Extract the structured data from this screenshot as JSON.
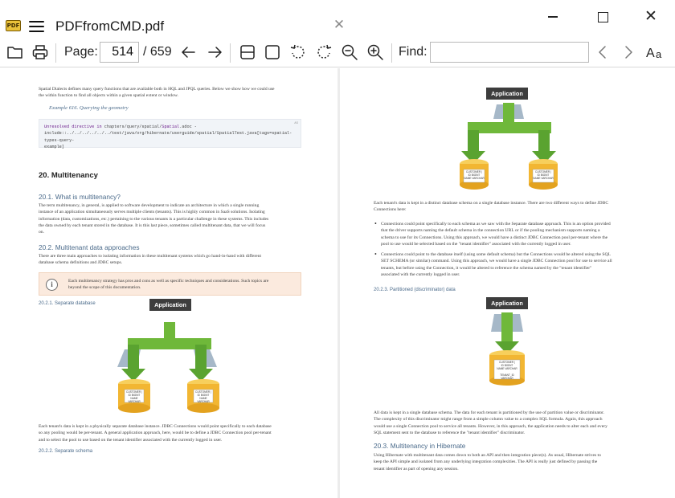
{
  "window": {
    "logo_text": "PDF",
    "tab_title": "PDFfromCMD.pdf"
  },
  "toolbar": {
    "page_label": "Page:",
    "page_current": "514",
    "page_total": "/ 659",
    "find_label": "Find:",
    "find_value": ""
  },
  "left_page": {
    "intro_line1": "Spatial Dialects defines many query functions that are available both in HQL and JPQL queries. Below we show how we could use",
    "intro_line2": "the within function to find all objects within a given spatial extent or window.",
    "example_caption": "Example 616. Querying the geometry",
    "code_line1_keyword": "Unresolved directive in",
    "code_line1_path": " chapters/query/spatial/",
    "code_line1_file": "Spatial",
    "code_line1_rest": ".adoc -",
    "code_line2": "include::../../../../../../test/java/org/hibernate/userguide/spatial/SpatialTest.java[tags=spatial-types-query-",
    "code_line3": "example]",
    "code_badge": "AS",
    "h_multitenancy": "20. Multitenancy",
    "h_what": "20.1. What is multitenancy?",
    "what_text": [
      "The term multitenancy, in general, is applied to software development to indicate an architecture in which a single running",
      "instance of an application simultaneously serves multiple clients (tenants). This is highly common in SaaS solutions. Isolating",
      "information (data, customizations, etc.) pertaining to the various tenants is a particular challenge in these systems. This includes",
      "the data owned by each tenant stored in the database. It is this last piece, sometimes called multitenant data, that we will focus",
      "on."
    ],
    "h_approaches": "20.2. Multitenant data approaches",
    "approaches_text": [
      "There are three main approaches to isolating information in these multitenant systems which go hand-in-hand with different",
      "database schema definitions and JDBC setups."
    ],
    "note_text": [
      "Each multitenancy strategy has pros and cons as well as specific techniques and considerations. Such topics are",
      "beyond the scope of this documentation."
    ],
    "h_separate_db": "20.2.1. Separate database",
    "diagram_label": "Application",
    "db_label_lines": [
      "CUSTOMER |",
      "ID BIGINT",
      "NAME VARCHAR"
    ],
    "separate_db_text": [
      "Each tenant's data is kept in a physically separate database instance. JDBC Connections would point specifically to each database",
      "so any pooling would be per-tenant. A general application approach, here, would be to define a JDBC Connection pool per-tenant",
      "and to select the pool to use based on the tenant identifier associated with the currently logged in user."
    ],
    "h_separate_schema": "20.2.2. Separate schema"
  },
  "right_page": {
    "diagram_label": "Application",
    "db_label_lines": [
      "CUSTOMER |",
      "ID BIGINT",
      "NAME VARCHAR"
    ],
    "schema_text": [
      "Each tenant's data is kept in a distinct database schema on a single database instance. There are two different ways to define JDBC",
      "Connections here:"
    ],
    "bullet1": [
      "Connections could point specifically to each schema as we saw with the Separate database approach. This is an option provided",
      "that the driver supports naming the default schema in the connection URL or if the pooling mechanism supports naming a",
      "schema to use for its Connections. Using this approach, we would have a distinct JDBC Connection pool per-tenant where the",
      "pool to use would be selected based on the \"tenant identifier\" associated with the currently logged in user."
    ],
    "bullet2": [
      "Connections could point to the database itself (using some default schema) but the Connections would be altered using the SQL",
      "SET SCHEMA (or similar) command. Using this approach, we would have a single JDBC Connection pool for use to service all",
      "tenants, but before using the Connection, it would be altered to reference the schema named by the \"tenant identifier\"",
      "associated with the currently logged in user."
    ],
    "h_partitioned": "20.2.3. Partitioned (discriminator) data",
    "diagram2_label": "Application",
    "db2_label_lines": [
      "CUSTOMER |",
      "ID BIGINT",
      "NAME VARCHAR",
      "",
      "TENANT_ID VARCHAR"
    ],
    "partitioned_text": [
      "All data is kept in a single database schema. The data for each tenant is partitioned by the use of partition value or discriminator.",
      "The complexity of this discriminator might range from a simple column value to a complex SQL formula. Again, this approach",
      "would use a single Connection pool to service all tenants. However, in this approach, the application needs to alter each and every",
      "SQL statement sent to the database to reference the \"tenant identifier\" discriminator."
    ],
    "h_hibernate": "20.3. Multitenancy in Hibernate",
    "hibernate_text": [
      "Using Hibernate with multitenant data comes down to both an API and then integration piece(s). As usual, Hibernate strives to",
      "keep the API simple and isolated from any underlying integration complexities. The API is really just defined by passing the",
      "tenant identifier as part of opening any session."
    ]
  },
  "colors": {
    "heading_blue": "#4a6a8a",
    "arrow_green": "#6fb83a",
    "db_gold": "#f2b632",
    "note_bg": "#fbeade"
  }
}
